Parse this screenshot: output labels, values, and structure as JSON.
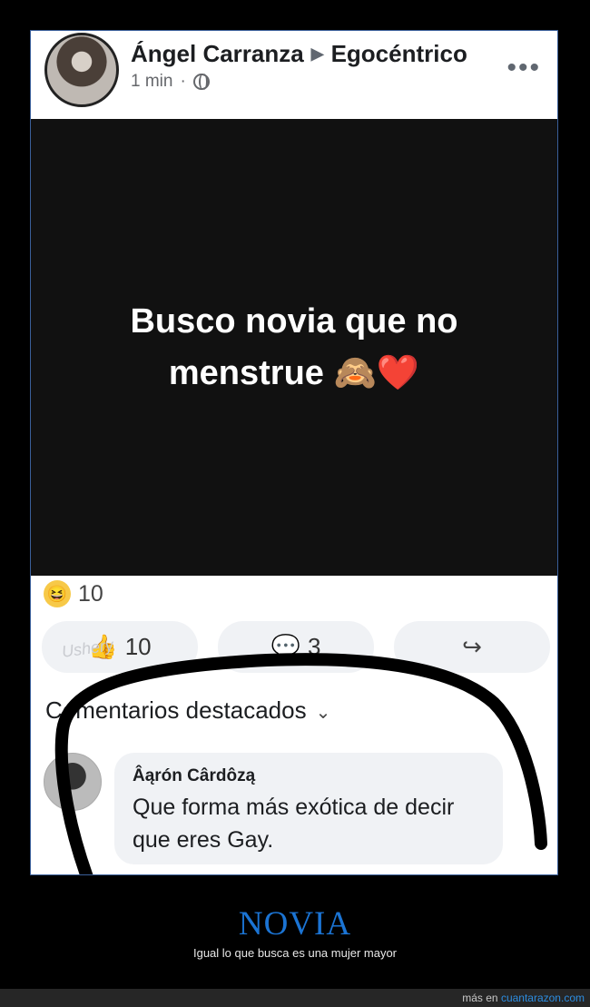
{
  "post": {
    "author": "Ángel Carranza",
    "arrow": "▶",
    "feeling": "Egocéntrico",
    "time": "1 min",
    "dot": "·",
    "more": "•••",
    "text_line1": "Busco novia que no",
    "text_line2": "menstrue",
    "emoji": "🙈❤️"
  },
  "reactions": {
    "icon": "😆",
    "count": "10"
  },
  "actions": {
    "like_icon": "👍",
    "like_count": "10",
    "comment_icon": "💬",
    "comment_count": "3",
    "share_icon": "↪"
  },
  "comments": {
    "header": "Comentarios destacados",
    "chevron": "⌄",
    "top": {
      "author": "Âąrón Cârdôzą",
      "text": "Que forma más exótica de decir que eres Gay."
    }
  },
  "watermark": "Ushery",
  "caption": {
    "title": "NOVIA",
    "subtitle": "Igual lo que busca es una mujer mayor"
  },
  "footer": {
    "prefix": "más en ",
    "site": "cuantarazon.com"
  },
  "colors": {
    "accent": "#1b74d4",
    "facebook_gray": "#f0f2f5"
  },
  "icons": [
    "globe-icon",
    "more-icon",
    "haha-icon",
    "like-icon",
    "comment-icon",
    "share-icon",
    "chevron-down-icon"
  ]
}
